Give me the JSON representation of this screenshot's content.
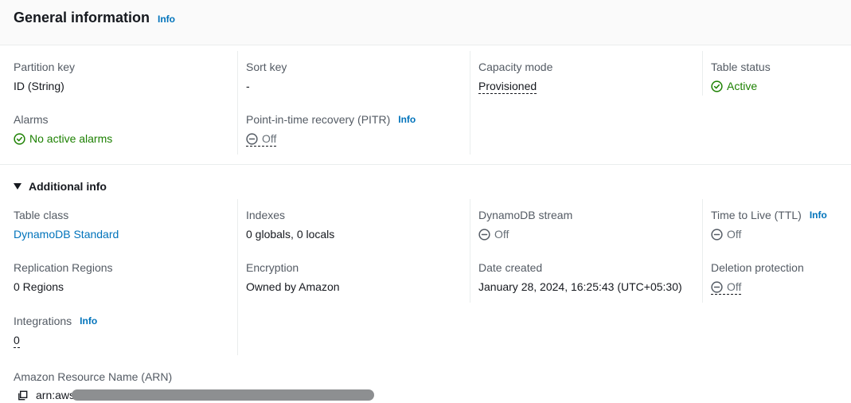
{
  "header": {
    "title": "General information",
    "info": "Info"
  },
  "fields": {
    "partition_key": {
      "label": "Partition key",
      "value": "ID (String)"
    },
    "sort_key": {
      "label": "Sort key",
      "value": "-"
    },
    "capacity_mode": {
      "label": "Capacity mode",
      "value": "Provisioned"
    },
    "table_status": {
      "label": "Table status",
      "value": "Active"
    },
    "alarms": {
      "label": "Alarms",
      "value": "No active alarms"
    },
    "pitr": {
      "label": "Point-in-time recovery (PITR)",
      "info": "Info",
      "value": "Off"
    }
  },
  "additional": {
    "toggle_label": "Additional info",
    "table_class": {
      "label": "Table class",
      "value": "DynamoDB Standard"
    },
    "indexes": {
      "label": "Indexes",
      "value": "0 globals, 0 locals"
    },
    "stream": {
      "label": "DynamoDB stream",
      "value": "Off"
    },
    "ttl": {
      "label": "Time to Live (TTL)",
      "info": "Info",
      "value": "Off"
    },
    "replication": {
      "label": "Replication Regions",
      "value": "0 Regions"
    },
    "encryption": {
      "label": "Encryption",
      "value": "Owned by Amazon"
    },
    "date_created": {
      "label": "Date created",
      "value": "January 28, 2024, 16:25:43 (UTC+05:30)"
    },
    "deletion_protection": {
      "label": "Deletion protection",
      "value": "Off"
    },
    "integrations": {
      "label": "Integrations",
      "info": "Info",
      "value": "0"
    },
    "arn": {
      "label": "Amazon Resource Name (ARN)",
      "value_prefix": "arn:aws"
    }
  },
  "colors": {
    "success": "#1d8102",
    "link": "#0073bb",
    "muted": "#687078"
  },
  "icons": {
    "status_ok": "check-circle-icon",
    "off": "minus-circle-icon",
    "copy": "copy-icon",
    "expand": "caret-down-icon"
  }
}
